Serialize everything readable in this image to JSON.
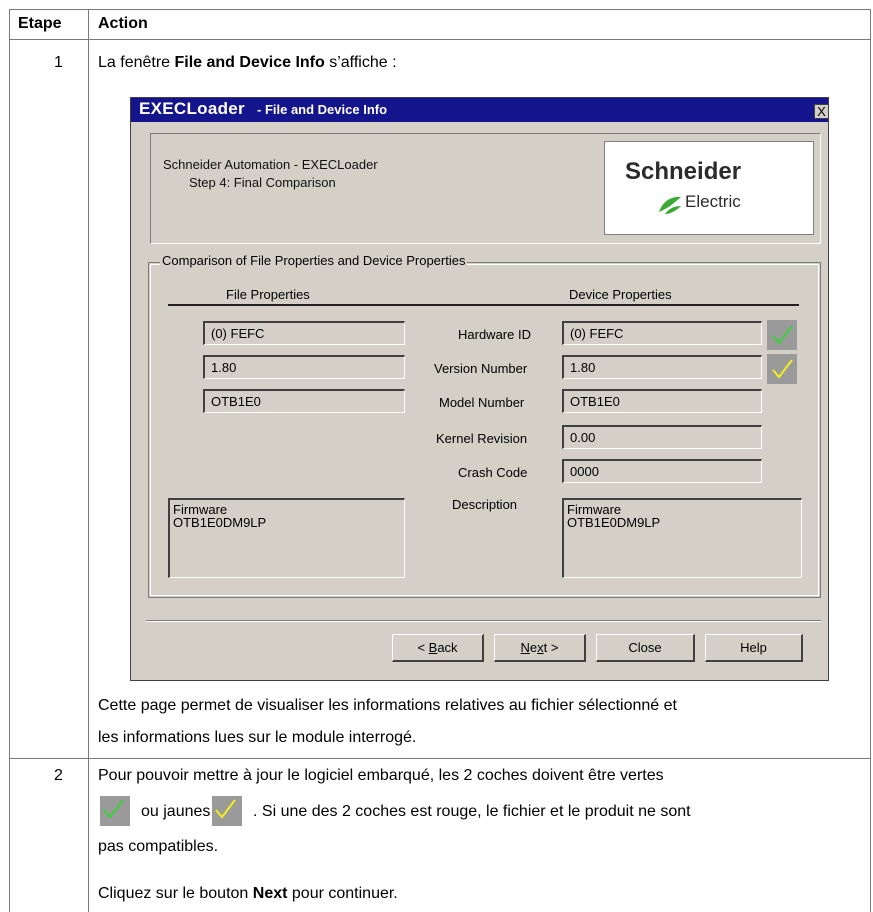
{
  "table": {
    "header_step": "Etape",
    "header_action": "Action",
    "rows": [
      {
        "step": "1",
        "intro_prefix": "La fenêtre ",
        "intro_bold": "File and Device Info",
        "intro_suffix": " s’affiche :",
        "desc_line1": "Cette page permet de visualiser les informations relatives au fichier sélectionné et",
        "desc_line2": "les informations lues sur le module interrogé."
      },
      {
        "step": "2",
        "line1": "Pour pouvoir mettre à jour le logiciel embarqué, les 2 coches doivent être vertes",
        "line2_mid": "ou jaunes",
        "line2_end": ". Si une des 2 coches est rouge, le fichier et le produit ne sont",
        "line3": "pas compatibles.",
        "line4_prefix": "Cliquez sur le bouton ",
        "line4_bold": "Next",
        "line4_suffix": " pour continuer."
      }
    ]
  },
  "dialog": {
    "title_app": "EXECLoader",
    "title_rest": " - File and Device Info",
    "close_label": "X",
    "header_line1": "Schneider Automation - EXECLoader",
    "header_line2": "Step 4: Final Comparison",
    "logo_brand": "Schneider",
    "logo_sub": "Electric",
    "group_label": "Comparison of File Properties and Device Properties",
    "file_props_heading": "File Properties",
    "device_props_heading": "Device Properties",
    "file_values": [
      "(0) FEFC",
      "1.80",
      "OTB1E0"
    ],
    "labels": [
      "Hardware ID",
      "Version Number",
      "Model Number",
      "Kernel Revision",
      "Crash Code",
      "Description"
    ],
    "device_values": [
      "(0) FEFC",
      "1.80",
      "OTB1E0",
      "0.00",
      "0000"
    ],
    "file_description": [
      "Firmware",
      "OTB1E0DM9LP"
    ],
    "device_description": [
      "Firmware",
      "OTB1E0DM9LP"
    ],
    "check_colors": {
      "hardware_id": "#3ad23a",
      "version_number": "#f0f020"
    },
    "buttons": {
      "back_pre": "< ",
      "back_u": "B",
      "back_post": "ack",
      "next_u": "N",
      "next_mid": "e",
      "next_u2": "x",
      "next_post": "t >",
      "close": "Close",
      "help": "Help"
    }
  },
  "colors": {
    "title_bar": "#14148c",
    "dialog_bg": "#d4d0c8",
    "check_green": "#3ad23a",
    "check_yellow": "#f0f020"
  }
}
